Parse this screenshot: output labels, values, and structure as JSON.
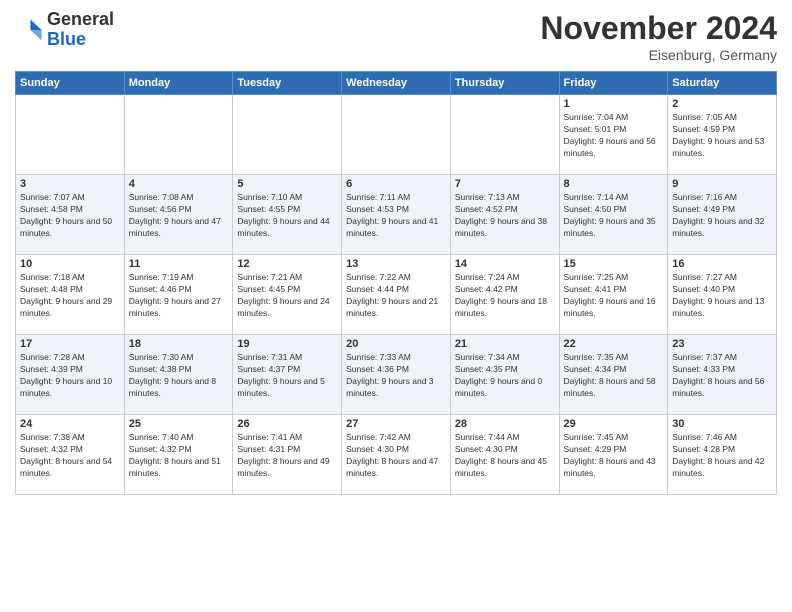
{
  "logo": {
    "general": "General",
    "blue": "Blue"
  },
  "header": {
    "title": "November 2024",
    "location": "Eisenburg, Germany"
  },
  "weekdays": [
    "Sunday",
    "Monday",
    "Tuesday",
    "Wednesday",
    "Thursday",
    "Friday",
    "Saturday"
  ],
  "weeks": [
    [
      {
        "day": "",
        "info": ""
      },
      {
        "day": "",
        "info": ""
      },
      {
        "day": "",
        "info": ""
      },
      {
        "day": "",
        "info": ""
      },
      {
        "day": "",
        "info": ""
      },
      {
        "day": "1",
        "info": "Sunrise: 7:04 AM\nSunset: 5:01 PM\nDaylight: 9 hours and 56 minutes."
      },
      {
        "day": "2",
        "info": "Sunrise: 7:05 AM\nSunset: 4:59 PM\nDaylight: 9 hours and 53 minutes."
      }
    ],
    [
      {
        "day": "3",
        "info": "Sunrise: 7:07 AM\nSunset: 4:58 PM\nDaylight: 9 hours and 50 minutes."
      },
      {
        "day": "4",
        "info": "Sunrise: 7:08 AM\nSunset: 4:56 PM\nDaylight: 9 hours and 47 minutes."
      },
      {
        "day": "5",
        "info": "Sunrise: 7:10 AM\nSunset: 4:55 PM\nDaylight: 9 hours and 44 minutes."
      },
      {
        "day": "6",
        "info": "Sunrise: 7:11 AM\nSunset: 4:53 PM\nDaylight: 9 hours and 41 minutes."
      },
      {
        "day": "7",
        "info": "Sunrise: 7:13 AM\nSunset: 4:52 PM\nDaylight: 9 hours and 38 minutes."
      },
      {
        "day": "8",
        "info": "Sunrise: 7:14 AM\nSunset: 4:50 PM\nDaylight: 9 hours and 35 minutes."
      },
      {
        "day": "9",
        "info": "Sunrise: 7:16 AM\nSunset: 4:49 PM\nDaylight: 9 hours and 32 minutes."
      }
    ],
    [
      {
        "day": "10",
        "info": "Sunrise: 7:18 AM\nSunset: 4:48 PM\nDaylight: 9 hours and 29 minutes."
      },
      {
        "day": "11",
        "info": "Sunrise: 7:19 AM\nSunset: 4:46 PM\nDaylight: 9 hours and 27 minutes."
      },
      {
        "day": "12",
        "info": "Sunrise: 7:21 AM\nSunset: 4:45 PM\nDaylight: 9 hours and 24 minutes."
      },
      {
        "day": "13",
        "info": "Sunrise: 7:22 AM\nSunset: 4:44 PM\nDaylight: 9 hours and 21 minutes."
      },
      {
        "day": "14",
        "info": "Sunrise: 7:24 AM\nSunset: 4:42 PM\nDaylight: 9 hours and 18 minutes."
      },
      {
        "day": "15",
        "info": "Sunrise: 7:25 AM\nSunset: 4:41 PM\nDaylight: 9 hours and 16 minutes."
      },
      {
        "day": "16",
        "info": "Sunrise: 7:27 AM\nSunset: 4:40 PM\nDaylight: 9 hours and 13 minutes."
      }
    ],
    [
      {
        "day": "17",
        "info": "Sunrise: 7:28 AM\nSunset: 4:39 PM\nDaylight: 9 hours and 10 minutes."
      },
      {
        "day": "18",
        "info": "Sunrise: 7:30 AM\nSunset: 4:38 PM\nDaylight: 9 hours and 8 minutes."
      },
      {
        "day": "19",
        "info": "Sunrise: 7:31 AM\nSunset: 4:37 PM\nDaylight: 9 hours and 5 minutes."
      },
      {
        "day": "20",
        "info": "Sunrise: 7:33 AM\nSunset: 4:36 PM\nDaylight: 9 hours and 3 minutes."
      },
      {
        "day": "21",
        "info": "Sunrise: 7:34 AM\nSunset: 4:35 PM\nDaylight: 9 hours and 0 minutes."
      },
      {
        "day": "22",
        "info": "Sunrise: 7:35 AM\nSunset: 4:34 PM\nDaylight: 8 hours and 58 minutes."
      },
      {
        "day": "23",
        "info": "Sunrise: 7:37 AM\nSunset: 4:33 PM\nDaylight: 8 hours and 56 minutes."
      }
    ],
    [
      {
        "day": "24",
        "info": "Sunrise: 7:38 AM\nSunset: 4:32 PM\nDaylight: 8 hours and 54 minutes."
      },
      {
        "day": "25",
        "info": "Sunrise: 7:40 AM\nSunset: 4:32 PM\nDaylight: 8 hours and 51 minutes."
      },
      {
        "day": "26",
        "info": "Sunrise: 7:41 AM\nSunset: 4:31 PM\nDaylight: 8 hours and 49 minutes."
      },
      {
        "day": "27",
        "info": "Sunrise: 7:42 AM\nSunset: 4:30 PM\nDaylight: 8 hours and 47 minutes."
      },
      {
        "day": "28",
        "info": "Sunrise: 7:44 AM\nSunset: 4:30 PM\nDaylight: 8 hours and 45 minutes."
      },
      {
        "day": "29",
        "info": "Sunrise: 7:45 AM\nSunset: 4:29 PM\nDaylight: 8 hours and 43 minutes."
      },
      {
        "day": "30",
        "info": "Sunrise: 7:46 AM\nSunset: 4:28 PM\nDaylight: 8 hours and 42 minutes."
      }
    ]
  ]
}
